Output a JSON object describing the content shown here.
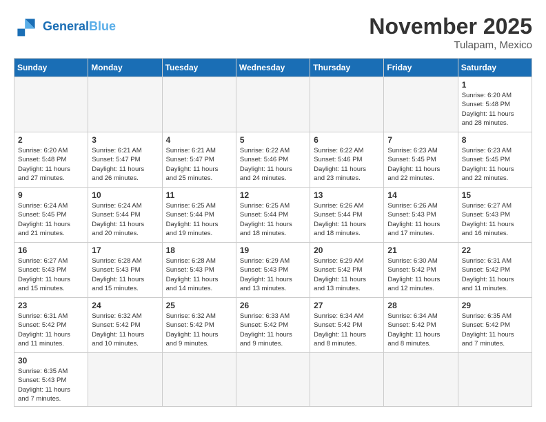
{
  "header": {
    "logo_general": "General",
    "logo_blue": "Blue",
    "month_title": "November 2025",
    "location": "Tulapam, Mexico"
  },
  "days_of_week": [
    "Sunday",
    "Monday",
    "Tuesday",
    "Wednesday",
    "Thursday",
    "Friday",
    "Saturday"
  ],
  "weeks": [
    [
      {
        "day": "",
        "info": ""
      },
      {
        "day": "",
        "info": ""
      },
      {
        "day": "",
        "info": ""
      },
      {
        "day": "",
        "info": ""
      },
      {
        "day": "",
        "info": ""
      },
      {
        "day": "",
        "info": ""
      },
      {
        "day": "1",
        "info": "Sunrise: 6:20 AM\nSunset: 5:48 PM\nDaylight: 11 hours\nand 28 minutes."
      }
    ],
    [
      {
        "day": "2",
        "info": "Sunrise: 6:20 AM\nSunset: 5:48 PM\nDaylight: 11 hours\nand 27 minutes."
      },
      {
        "day": "3",
        "info": "Sunrise: 6:21 AM\nSunset: 5:47 PM\nDaylight: 11 hours\nand 26 minutes."
      },
      {
        "day": "4",
        "info": "Sunrise: 6:21 AM\nSunset: 5:47 PM\nDaylight: 11 hours\nand 25 minutes."
      },
      {
        "day": "5",
        "info": "Sunrise: 6:22 AM\nSunset: 5:46 PM\nDaylight: 11 hours\nand 24 minutes."
      },
      {
        "day": "6",
        "info": "Sunrise: 6:22 AM\nSunset: 5:46 PM\nDaylight: 11 hours\nand 23 minutes."
      },
      {
        "day": "7",
        "info": "Sunrise: 6:23 AM\nSunset: 5:45 PM\nDaylight: 11 hours\nand 22 minutes."
      },
      {
        "day": "8",
        "info": "Sunrise: 6:23 AM\nSunset: 5:45 PM\nDaylight: 11 hours\nand 22 minutes."
      }
    ],
    [
      {
        "day": "9",
        "info": "Sunrise: 6:24 AM\nSunset: 5:45 PM\nDaylight: 11 hours\nand 21 minutes."
      },
      {
        "day": "10",
        "info": "Sunrise: 6:24 AM\nSunset: 5:44 PM\nDaylight: 11 hours\nand 20 minutes."
      },
      {
        "day": "11",
        "info": "Sunrise: 6:25 AM\nSunset: 5:44 PM\nDaylight: 11 hours\nand 19 minutes."
      },
      {
        "day": "12",
        "info": "Sunrise: 6:25 AM\nSunset: 5:44 PM\nDaylight: 11 hours\nand 18 minutes."
      },
      {
        "day": "13",
        "info": "Sunrise: 6:26 AM\nSunset: 5:44 PM\nDaylight: 11 hours\nand 18 minutes."
      },
      {
        "day": "14",
        "info": "Sunrise: 6:26 AM\nSunset: 5:43 PM\nDaylight: 11 hours\nand 17 minutes."
      },
      {
        "day": "15",
        "info": "Sunrise: 6:27 AM\nSunset: 5:43 PM\nDaylight: 11 hours\nand 16 minutes."
      }
    ],
    [
      {
        "day": "16",
        "info": "Sunrise: 6:27 AM\nSunset: 5:43 PM\nDaylight: 11 hours\nand 15 minutes."
      },
      {
        "day": "17",
        "info": "Sunrise: 6:28 AM\nSunset: 5:43 PM\nDaylight: 11 hours\nand 15 minutes."
      },
      {
        "day": "18",
        "info": "Sunrise: 6:28 AM\nSunset: 5:43 PM\nDaylight: 11 hours\nand 14 minutes."
      },
      {
        "day": "19",
        "info": "Sunrise: 6:29 AM\nSunset: 5:43 PM\nDaylight: 11 hours\nand 13 minutes."
      },
      {
        "day": "20",
        "info": "Sunrise: 6:29 AM\nSunset: 5:42 PM\nDaylight: 11 hours\nand 13 minutes."
      },
      {
        "day": "21",
        "info": "Sunrise: 6:30 AM\nSunset: 5:42 PM\nDaylight: 11 hours\nand 12 minutes."
      },
      {
        "day": "22",
        "info": "Sunrise: 6:31 AM\nSunset: 5:42 PM\nDaylight: 11 hours\nand 11 minutes."
      }
    ],
    [
      {
        "day": "23",
        "info": "Sunrise: 6:31 AM\nSunset: 5:42 PM\nDaylight: 11 hours\nand 11 minutes."
      },
      {
        "day": "24",
        "info": "Sunrise: 6:32 AM\nSunset: 5:42 PM\nDaylight: 11 hours\nand 10 minutes."
      },
      {
        "day": "25",
        "info": "Sunrise: 6:32 AM\nSunset: 5:42 PM\nDaylight: 11 hours\nand 9 minutes."
      },
      {
        "day": "26",
        "info": "Sunrise: 6:33 AM\nSunset: 5:42 PM\nDaylight: 11 hours\nand 9 minutes."
      },
      {
        "day": "27",
        "info": "Sunrise: 6:34 AM\nSunset: 5:42 PM\nDaylight: 11 hours\nand 8 minutes."
      },
      {
        "day": "28",
        "info": "Sunrise: 6:34 AM\nSunset: 5:42 PM\nDaylight: 11 hours\nand 8 minutes."
      },
      {
        "day": "29",
        "info": "Sunrise: 6:35 AM\nSunset: 5:42 PM\nDaylight: 11 hours\nand 7 minutes."
      }
    ],
    [
      {
        "day": "30",
        "info": "Sunrise: 6:35 AM\nSunset: 5:43 PM\nDaylight: 11 hours\nand 7 minutes."
      },
      {
        "day": "",
        "info": ""
      },
      {
        "day": "",
        "info": ""
      },
      {
        "day": "",
        "info": ""
      },
      {
        "day": "",
        "info": ""
      },
      {
        "day": "",
        "info": ""
      },
      {
        "day": "",
        "info": ""
      }
    ]
  ]
}
